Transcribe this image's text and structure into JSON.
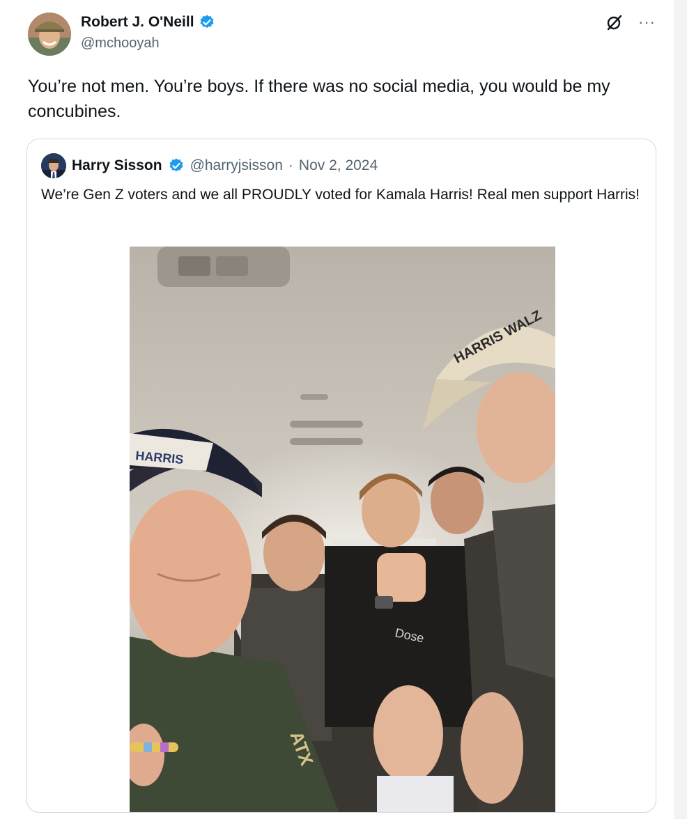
{
  "tweet": {
    "author_name": "Robert J. O'Neill",
    "author_handle": "@mchooyah",
    "text": "You’re not men. You’re boys. If there was no social media, you would be my concubines.",
    "more_label": "···"
  },
  "quoted_tweet": {
    "author_name": "Harry Sisson",
    "author_handle": "@harryjsisson",
    "separator": "·",
    "date": "Nov 2, 2024",
    "text": "We’re Gen Z voters and we all PROUDLY voted for Kamala Harris! Real men support Harris!",
    "photo": {
      "cap_left_text": "HARRIS",
      "cap_right_text": "HARRIS WALZ",
      "shirt_text": "ATX"
    }
  },
  "colors": {
    "verified_blue": "#1d9bf0",
    "text": "#0f1419",
    "secondary_text": "#536471",
    "border": "#cfd9de"
  },
  "icons": {
    "verified": "verified-badge-icon",
    "grok": "grok-icon",
    "more": "more-icon"
  }
}
